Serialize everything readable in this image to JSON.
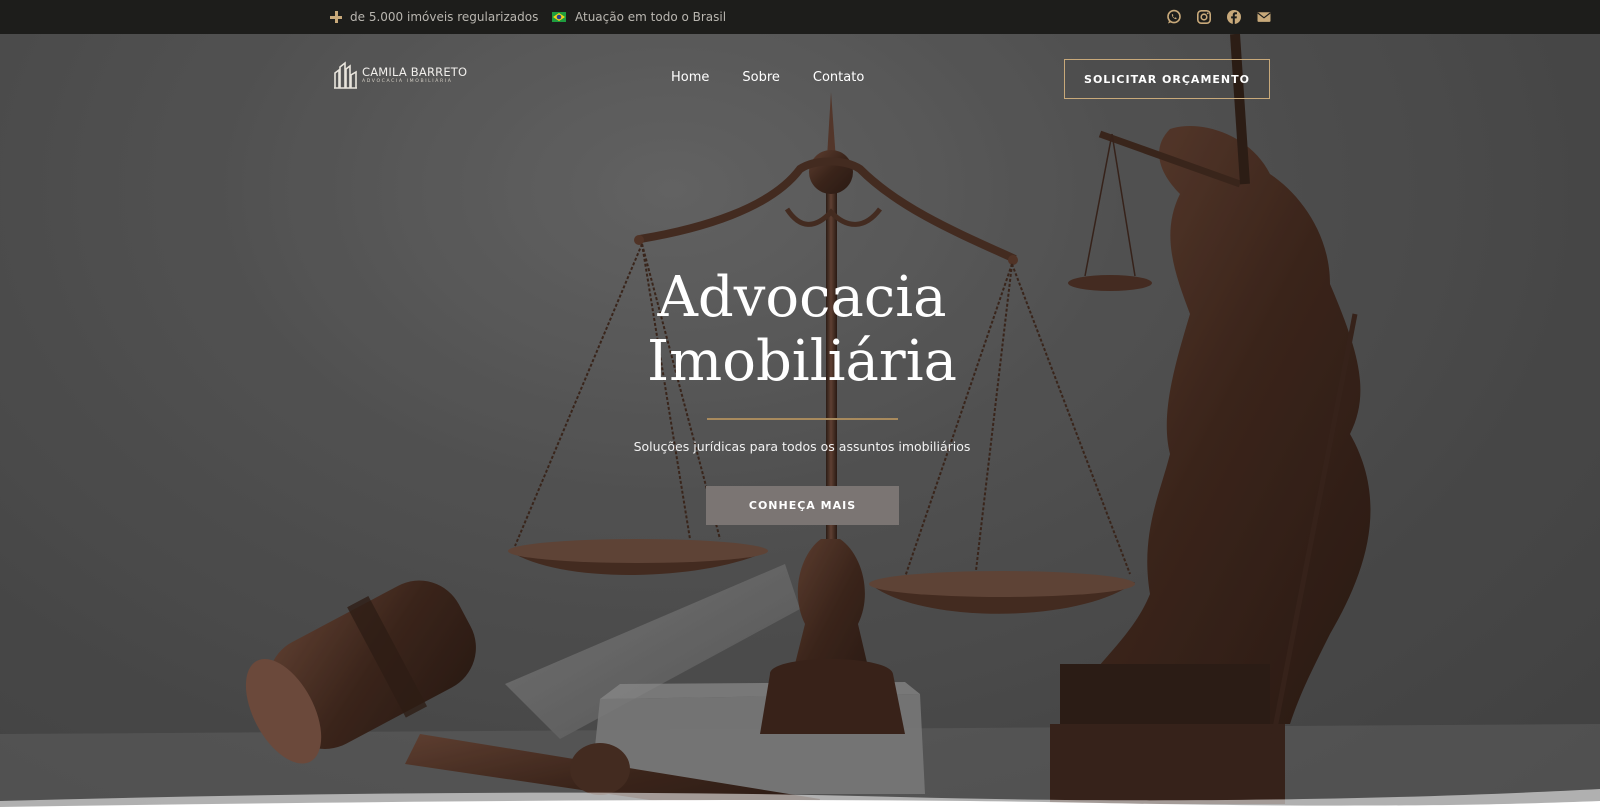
{
  "topbar": {
    "info_regularized": "de 5.000 imóveis regularizados",
    "info_coverage": "Atuação em todo o Brasil",
    "social_icons": [
      "whatsapp-icon",
      "instagram-icon",
      "facebook-icon",
      "envelope-icon"
    ]
  },
  "header": {
    "logo_name": "CAMILA BARRETO",
    "logo_tagline": "ADVOCACIA IMOBILIÁRIA",
    "nav": [
      "Home",
      "Sobre",
      "Contato"
    ],
    "cta_label": "SOLICITAR ORÇAMENTO"
  },
  "hero": {
    "title_line1": "Advocacia",
    "title_line2": "Imobiliária",
    "subtitle": "Soluções jurídicas para todos os assuntos imobiliários",
    "button_label": "CONHEÇA MAIS"
  },
  "colors": {
    "accent_gold": "#c8a97a",
    "topbar_bg": "#1d1d1b",
    "button_bg": "#7b7573",
    "bronze": "#4a2c1f"
  }
}
